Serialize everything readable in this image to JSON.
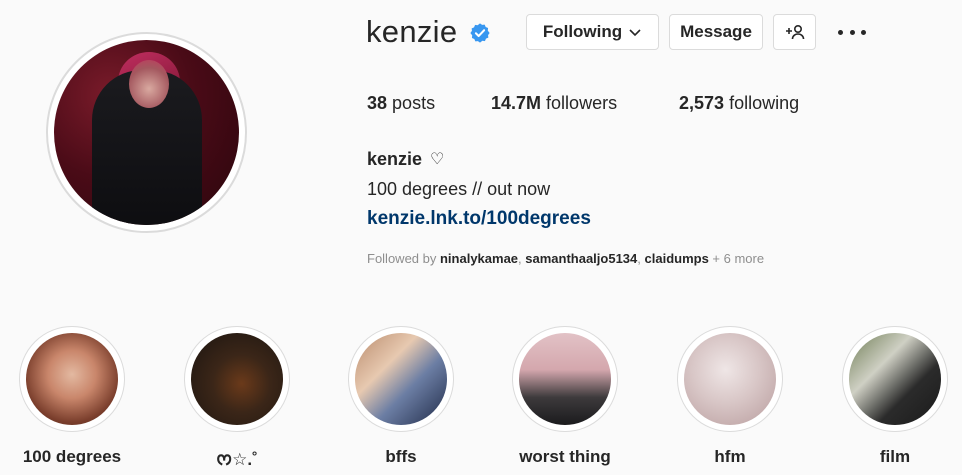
{
  "profile": {
    "username": "kenzie",
    "verified": true,
    "buttons": {
      "following": "Following",
      "message": "Message"
    },
    "stats": {
      "posts_count": "38",
      "posts_label": "posts",
      "followers_count": "14.7M",
      "followers_label": "followers",
      "following_count": "2,573",
      "following_label": "following"
    },
    "bio": {
      "name": "kenzie",
      "heart": "♡",
      "text": "100 degrees // out now",
      "link": "kenzie.lnk.to/100degrees"
    },
    "followed_by": {
      "prefix": "Followed by ",
      "user1": "ninalykamae",
      "sep1": ", ",
      "user2": "samanthaaljo5134",
      "sep2": ", ",
      "user3": "claidumps",
      "more": " + 6 more"
    }
  },
  "highlights": [
    {
      "label": "100 degrees"
    },
    {
      "label": "ᰔ☆.˚"
    },
    {
      "label": "bffs"
    },
    {
      "label": "worst thing"
    },
    {
      "label": "hfm"
    },
    {
      "label": "film"
    }
  ],
  "colors": {
    "accent_verified": "#3897f0",
    "link": "#00376b",
    "text": "#262626",
    "muted": "#8e8e8e"
  }
}
